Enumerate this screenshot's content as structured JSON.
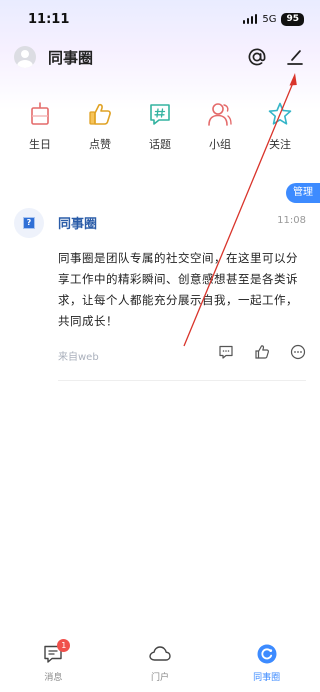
{
  "status_bar": {
    "time": "11:11",
    "network": "5G",
    "battery": "95"
  },
  "header": {
    "title": "同事圈"
  },
  "quick_actions": [
    {
      "label": "生日",
      "icon": "cake-icon"
    },
    {
      "label": "点赞",
      "icon": "thumbs-up-icon"
    },
    {
      "label": "话题",
      "icon": "hashtag-icon"
    },
    {
      "label": "小组",
      "icon": "group-icon"
    },
    {
      "label": "关注",
      "icon": "star-icon"
    }
  ],
  "manage_label": "管理",
  "post": {
    "author": "同事圈",
    "time": "11:08",
    "body": "同事圈是团队专属的社交空间，在这里可以分享工作中的精彩瞬间、创意感想甚至是各类诉求，让每个人都能充分展示自我，一起工作，共同成长！",
    "source": "来自web"
  },
  "tabs": [
    {
      "label": "消息",
      "icon": "message-icon",
      "badge": "1"
    },
    {
      "label": "门户",
      "icon": "cloud-icon"
    },
    {
      "label": "同事圈",
      "icon": "colleague-circle-icon",
      "active": true
    }
  ],
  "colors": {
    "accent": "#3d8bff",
    "badge": "#f0504b",
    "annotation_arrow": "#d9342b"
  }
}
